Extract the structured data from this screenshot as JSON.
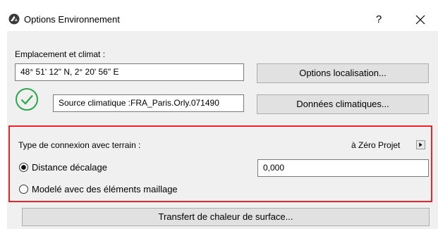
{
  "window": {
    "title": "Options Environnement",
    "help_label": "?",
    "close_label": "×"
  },
  "location": {
    "section_label": "Emplacement et climat :",
    "coordinates": "48° 51' 12\" N, 2° 20' 56\" E",
    "options_button": "Options localisation...",
    "climate_source": "Source climatique :FRA_Paris.Orly.071490",
    "climate_button": "Données climatiques...",
    "status_icon_color": "#2aa84a"
  },
  "ground": {
    "section_label": "Type de connexion avec terrain :",
    "reference_value": "à Zéro Projet",
    "options": [
      {
        "label": "Distance décalage",
        "selected": true
      },
      {
        "label": "Modelé avec des éléments maillage",
        "selected": false
      }
    ],
    "offset_value": "0,000",
    "highlight_color": "#e8272d"
  },
  "footer": {
    "transfer_button": "Transfert de chaleur de surface..."
  }
}
